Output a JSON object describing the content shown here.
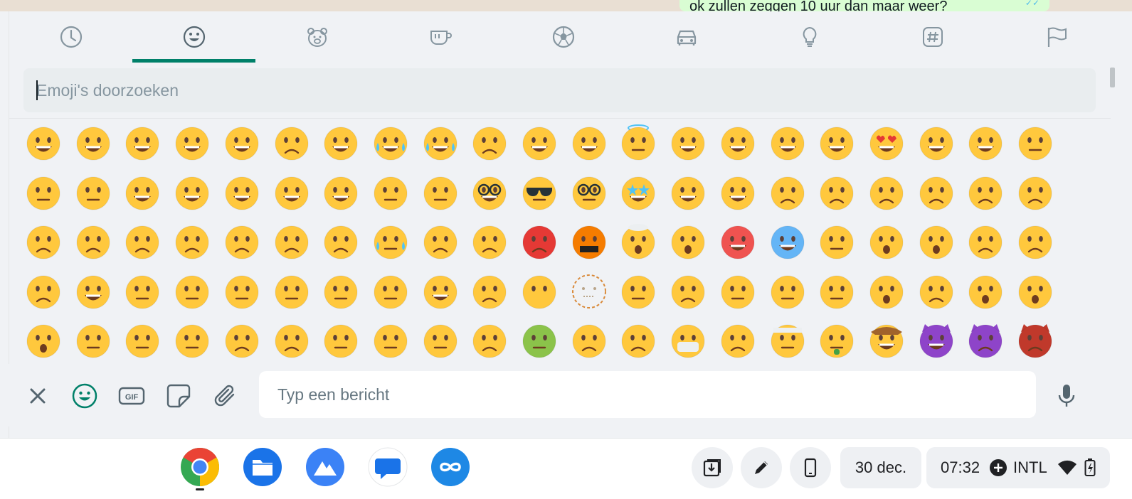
{
  "chat": {
    "last_message": "ok zullen zeggen 10 uur dan maar weer?"
  },
  "emoji_panel": {
    "tabs": [
      {
        "name": "tab-recent",
        "icon": "clock-icon"
      },
      {
        "name": "tab-smileys",
        "icon": "smiley-icon"
      },
      {
        "name": "tab-animals",
        "icon": "bear-icon"
      },
      {
        "name": "tab-food",
        "icon": "cup-icon"
      },
      {
        "name": "tab-activity",
        "icon": "soccer-ball-icon"
      },
      {
        "name": "tab-travel",
        "icon": "car-icon"
      },
      {
        "name": "tab-objects",
        "icon": "lightbulb-icon"
      },
      {
        "name": "tab-symbols",
        "icon": "hash-icon"
      },
      {
        "name": "tab-flags",
        "icon": "flag-icon"
      }
    ],
    "active_tab": "tab-smileys",
    "search": {
      "placeholder": "Emoji's doorzoeken",
      "value": ""
    },
    "accent_color": "#008069",
    "emoji_rows": [
      [
        "grinning",
        "smiley",
        "smile",
        "grin",
        "laughing",
        "holding-back-tears",
        "sweat-smile",
        "joy",
        "rofl",
        "smiling-tear",
        "relaxed",
        "blush",
        "innocent",
        "slightly-smiling",
        "upside-down",
        "relieved-smile",
        "relieved",
        "heart-eyes",
        "smiling-hearts",
        "kissing-heart",
        "kissing"
      ],
      [
        "kissing-smiling-eyes",
        "kissing-closed-eyes",
        "yum",
        "tongue",
        "squinting-tongue",
        "winking-tongue",
        "zany",
        "raised-eyebrow",
        "monocle",
        "nerd",
        "sunglasses",
        "disguised",
        "star-struck",
        "partying",
        "smirk",
        "unamused",
        "disappointed",
        "pensive",
        "worried",
        "confused",
        "slightly-frowning"
      ],
      [
        "frowning",
        "persevere",
        "confounded",
        "tired",
        "weary",
        "pleading",
        "cry",
        "sob",
        "triumph",
        "angry",
        "rage",
        "cursing",
        "exploding-head",
        "flushed",
        "hot",
        "cold",
        "face-in-clouds",
        "scream",
        "fearful",
        "cold-sweat",
        "disappointed-relieved"
      ],
      [
        "downcast-sweat",
        "hugging",
        "thinking",
        "peeking-eye",
        "hand-over-mouth",
        "open-eyes-hand-over-mouth",
        "saluting",
        "shushing",
        "melting",
        "lying",
        "no-mouth",
        "dotted-line",
        "neutral",
        "diagonal-mouth",
        "expressionless",
        "grimacing",
        "rolling-eyes",
        "hushed",
        "frowning-open-mouth",
        "anguished",
        "open-mouth"
      ],
      [
        "astonished",
        "yawning",
        "sleeping",
        "drooling",
        "sleepy",
        "face-exhaling",
        "dizzy",
        "spiral-eyes",
        "zipper-mouth",
        "woozy",
        "nauseated",
        "vomiting",
        "sneezing",
        "mask",
        "thermometer",
        "head-bandage",
        "money-mouth",
        "cowboy",
        "smiling-imp",
        "imp",
        "ogre"
      ]
    ]
  },
  "compose": {
    "close_icon": "close-icon",
    "emoji_icon": "smiley-icon",
    "gif_label": "GIF",
    "sticker_icon": "sticker-icon",
    "attach_icon": "paperclip-icon",
    "message": {
      "placeholder": "Typ een bericht",
      "value": ""
    },
    "mic_icon": "microphone-icon"
  },
  "shelf": {
    "apps": [
      {
        "name": "chrome-app",
        "icon": "chrome-icon"
      },
      {
        "name": "files-app",
        "icon": "folder-icon"
      },
      {
        "name": "vpn-app",
        "icon": "mountain-icon"
      },
      {
        "name": "messages-app",
        "icon": "chat-bubble-icon"
      },
      {
        "name": "infinity-app",
        "icon": "infinity-icon"
      }
    ],
    "tray": {
      "downloads_icon": "download-tray-icon",
      "pen_icon": "stylus-icon",
      "phone_icon": "phone-hub-icon",
      "date": "30 dec.",
      "time": "07:32",
      "keyboard": "INTL",
      "wifi_icon": "wifi-icon",
      "battery_icon": "battery-icon"
    }
  }
}
